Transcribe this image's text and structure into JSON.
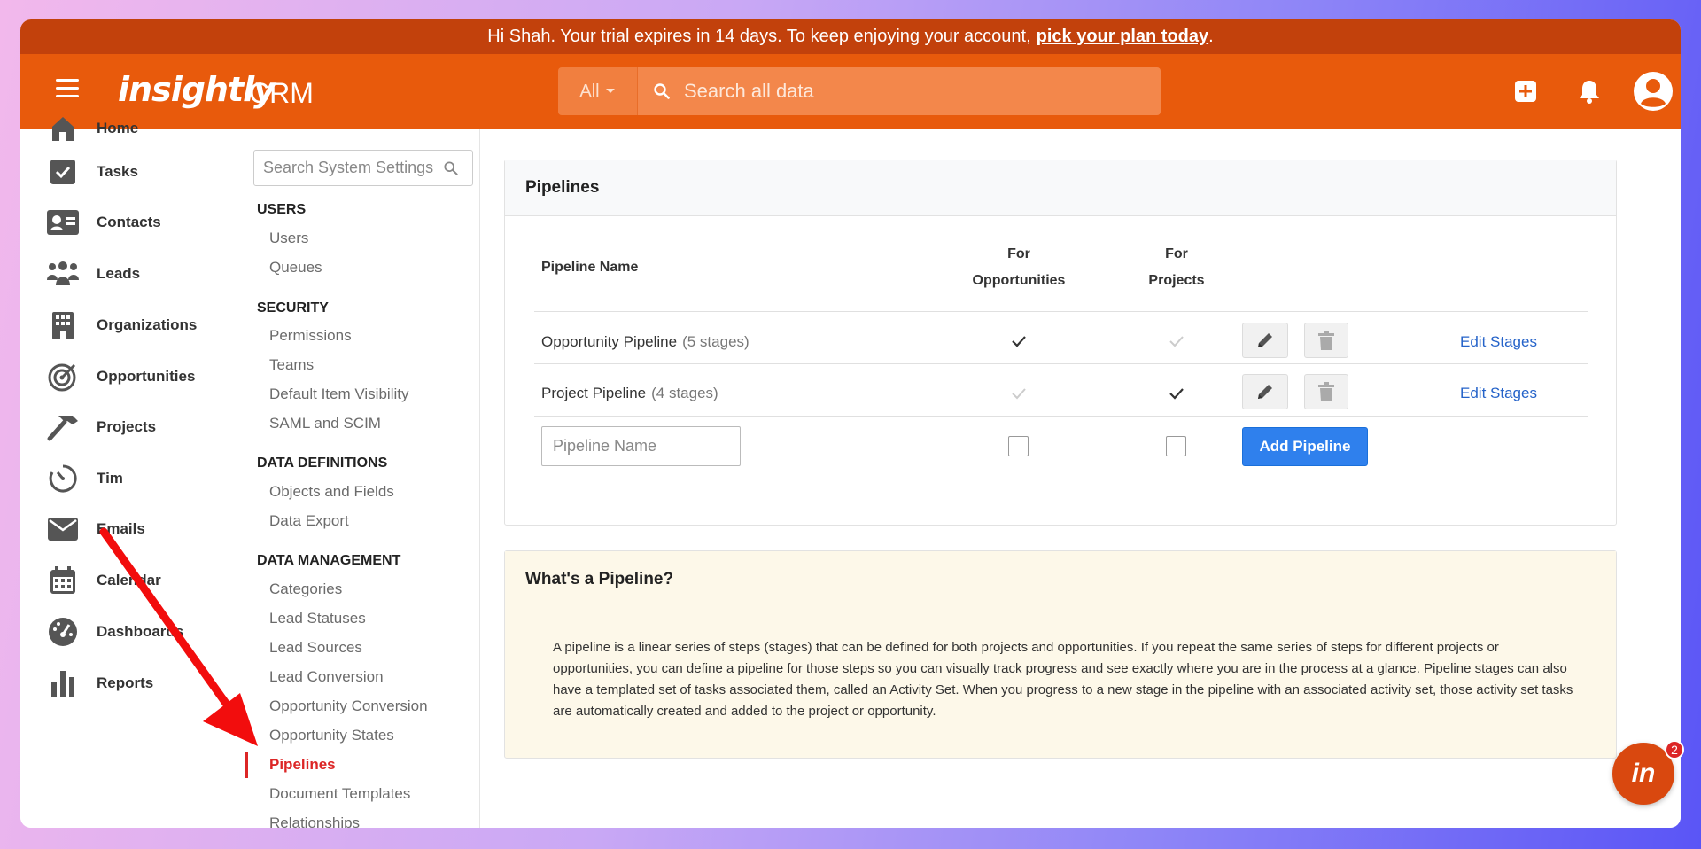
{
  "trial_banner": {
    "text": "Hi Shah. Your trial expires in 14 days. To keep enjoying your account,",
    "link": "pick your plan today",
    "suffix": "."
  },
  "header": {
    "logo": "insightly",
    "product": "CRM",
    "search_scope": "All",
    "search_placeholder": "Search all data"
  },
  "nav": {
    "items": [
      {
        "label": "Home",
        "icon": "home-icon"
      },
      {
        "label": "Tasks",
        "icon": "check-square-icon"
      },
      {
        "label": "Contacts",
        "icon": "contact-card-icon"
      },
      {
        "label": "Leads",
        "icon": "people-group-icon"
      },
      {
        "label": "Organizations",
        "icon": "building-icon"
      },
      {
        "label": "Opportunities",
        "icon": "target-icon"
      },
      {
        "label": "Projects",
        "icon": "hammer-icon"
      },
      {
        "label": "Tim",
        "icon": "stopwatch-icon"
      },
      {
        "label": "Emails",
        "icon": "envelope-icon"
      },
      {
        "label": "Calendar",
        "icon": "calendar-icon"
      },
      {
        "label": "Dashboards",
        "icon": "gauge-icon"
      },
      {
        "label": "Reports",
        "icon": "bar-chart-icon"
      }
    ]
  },
  "settings": {
    "search_placeholder": "Search System Settings",
    "users_head": "USERS",
    "users": [
      "Users",
      "Queues"
    ],
    "security_head": "SECURITY",
    "security": [
      "Permissions",
      "Teams",
      "Default Item Visibility",
      "SAML and SCIM"
    ],
    "defs_head": "DATA DEFINITIONS",
    "defs": [
      "Objects and Fields",
      "Data Export"
    ],
    "mgmt_head": "DATA MANAGEMENT",
    "mgmt": [
      "Categories",
      "Lead Statuses",
      "Lead Sources",
      "Lead Conversion",
      "Opportunity Conversion",
      "Opportunity States",
      "Pipelines",
      "Document Templates",
      "Relationships"
    ]
  },
  "pipelines": {
    "title": "Pipelines",
    "col_name": "Pipeline Name",
    "col_opp_1": "For",
    "col_opp_2": "Opportunities",
    "col_proj_1": "For",
    "col_proj_2": "Projects",
    "rows": [
      {
        "name": "Opportunity Pipeline",
        "stages": "(5 stages)",
        "for_opportunities": true,
        "for_projects": false,
        "edit": "Edit Stages"
      },
      {
        "name": "Project Pipeline",
        "stages": "(4 stages)",
        "for_opportunities": false,
        "for_projects": true,
        "edit": "Edit Stages"
      }
    ],
    "new_placeholder": "Pipeline Name",
    "add_button": "Add Pipeline"
  },
  "info": {
    "title": "What's a Pipeline?",
    "body": "A pipeline is a linear series of steps (stages) that can be defined for both projects and opportunities. If you repeat the same series of steps for different projects or opportunities, you can define a pipeline for those steps so you can visually track progress and see exactly where you are in the process at a glance. Pipeline stages can also have a templated set of tasks associated them, called an Activity Set. When you progress to a new stage in the pipeline with an associated activity set, those activity set tasks are automatically created and added to the project or opportunity."
  },
  "chat": {
    "label": "in",
    "badge": "2"
  },
  "colors": {
    "brand": "#e85a0c",
    "banner": "#c2410c",
    "active": "#dc2626",
    "link": "#2563c9",
    "button": "#2f80ed"
  }
}
